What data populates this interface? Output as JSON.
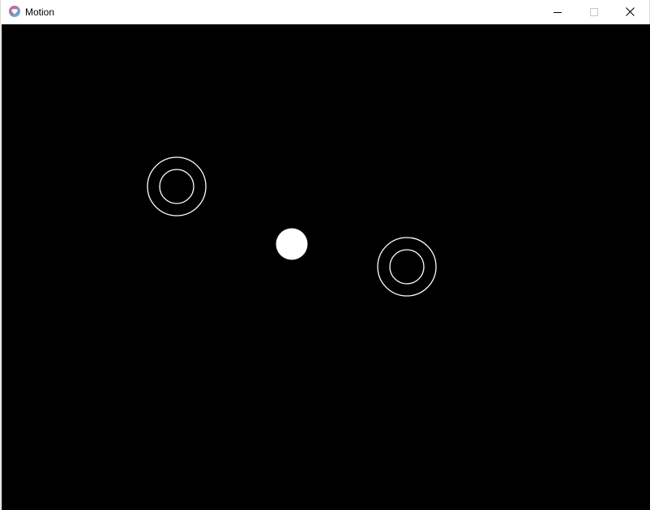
{
  "window": {
    "title": "Motion",
    "app_icon": "heart-app-icon",
    "controls": {
      "minimize_icon": "minimize-icon",
      "maximize_icon": "maximize-icon",
      "close_icon": "close-icon"
    }
  },
  "canvas": {
    "background": "#000000",
    "foreground": "#ffffff",
    "objects": [
      {
        "name": "target-ring-left",
        "shape": "double-ring"
      },
      {
        "name": "ball",
        "shape": "filled-circle"
      },
      {
        "name": "target-ring-right",
        "shape": "double-ring"
      }
    ]
  },
  "colors": {
    "icon_pink": "#e84b8a",
    "icon_cyan": "#3ec6e0"
  }
}
